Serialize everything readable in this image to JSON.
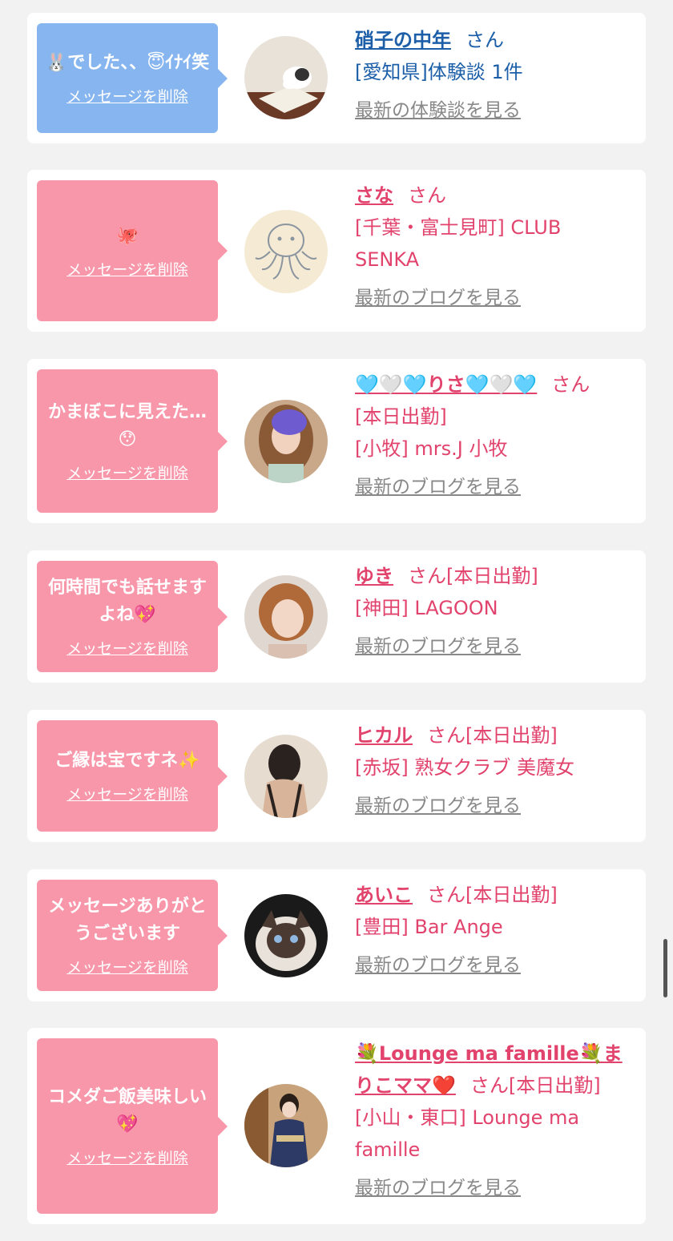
{
  "items": [
    {
      "message": "🐰でした、、😇ｲﾅｲ笑",
      "delete_label": "メッセージを削除",
      "name": "硝子の中年",
      "san": "さん",
      "line1": "[愛知県]体験談 1件",
      "line2": "",
      "link": "最新の体験談を見る",
      "avatar_icon": "cat-on-book"
    },
    {
      "message": "🐙",
      "delete_label": "メッセージを削除",
      "name": "さな",
      "san": "さん",
      "line1": "[千葉・富士見町] CLUB SENKA",
      "line2": "",
      "link": "最新のブログを見る",
      "avatar_icon": "octopus"
    },
    {
      "message": "かまぼこに見えた…😯",
      "delete_label": "メッセージを削除",
      "name": "🩵🤍🩵りさ🩵🤍🩵",
      "san": "さん",
      "line1": "[本日出勤]",
      "line2": "[小牧] mrs.J 小牧",
      "link": "最新のブログを見る",
      "avatar_icon": "woman-long-hair"
    },
    {
      "message": "何時間でも話せますよね💖",
      "delete_label": "メッセージを削除",
      "name": "ゆき",
      "san": "さん[本日出勤]",
      "line1": "[神田] LAGOON",
      "line2": "",
      "link": "最新のブログを見る",
      "avatar_icon": "woman-short-hair"
    },
    {
      "message": "ご縁は宝ですネ✨",
      "delete_label": "メッセージを削除",
      "name": "ヒカル",
      "san": "さん[本日出勤]",
      "line1": "[赤坂] 熟女クラブ 美魔女",
      "line2": "",
      "link": "最新のブログを見る",
      "avatar_icon": "woman-back"
    },
    {
      "message": "メッセージありがとうございます",
      "delete_label": "メッセージを削除",
      "name": "あいこ",
      "san": "さん[本日出勤]",
      "line1": "[豊田] Bar Ange",
      "line2": "",
      "link": "最新のブログを見る",
      "avatar_icon": "himalayan-cat"
    },
    {
      "message": "コメダご飯美味しい💖",
      "delete_label": "メッセージを削除",
      "name": "💐Lounge ma famille💐まりこママ❤️",
      "san": "さん[本日出勤]",
      "line1": "[小山・東口] Lounge ma famille",
      "line2": "",
      "link": "最新のブログを見る",
      "avatar_icon": "woman-kimono"
    }
  ],
  "colors": {
    "blue_bubble": "#86b5ef",
    "pink_bubble": "#f897aa",
    "blue_text": "#1c5fa8",
    "pink_text": "#e2436d"
  }
}
